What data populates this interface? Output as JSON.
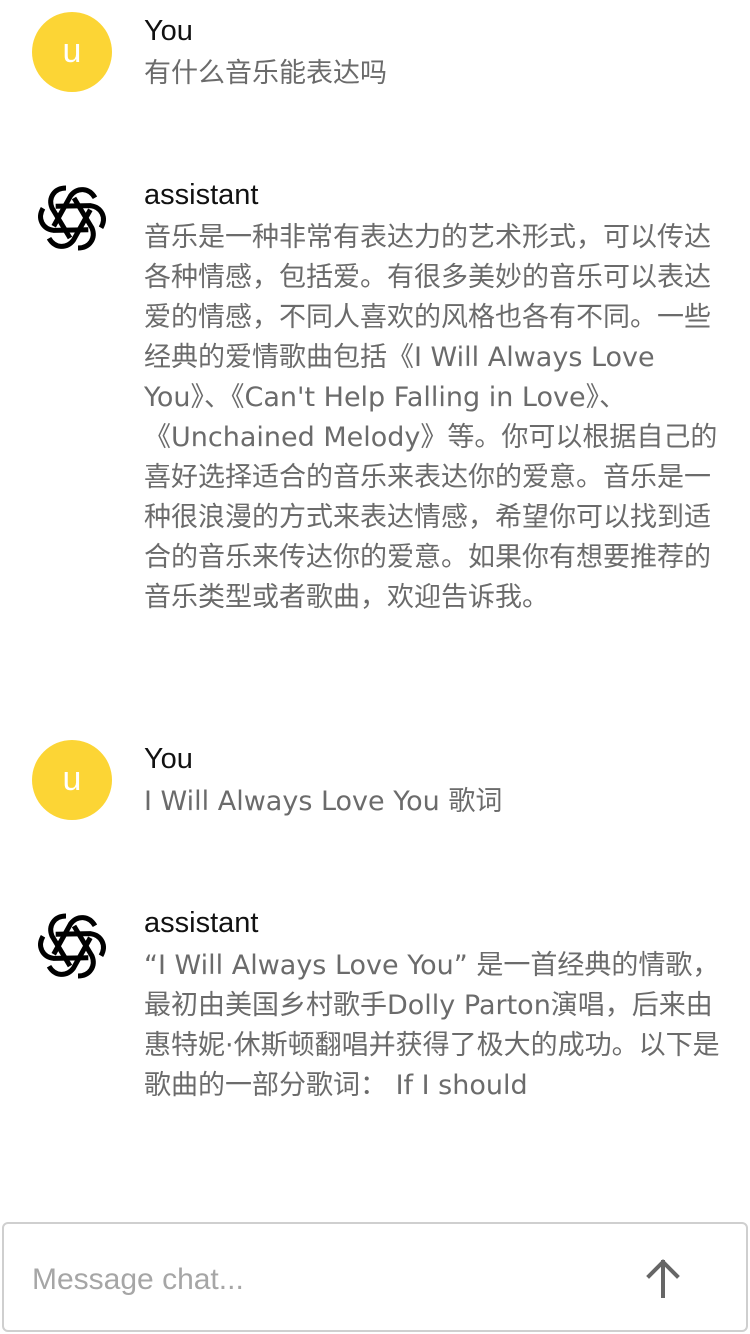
{
  "messages": [
    {
      "role": "You",
      "avatar_letter": "u",
      "text": "有什么音乐能表达吗"
    },
    {
      "role": "assistant",
      "avatar_icon": "openai-logo-icon",
      "text": "音乐是一种非常有表达力的艺术形式，可以传达各种情感，包括爱。有很多美妙的音乐可以表达爱的情感，不同人喜欢的风格也各有不同。一些经典的爱情歌曲包括《I Will Always Love You》、《Can't Help Falling in Love》、《Unchained Melody》等。你可以根据自己的喜好选择适合的音乐来表达你的爱意。音乐是一种很浪漫的方式来表达情感，希望你可以找到适合的音乐来传达你的爱意。如果你有想要推荐的音乐类型或者歌曲，欢迎告诉我。"
    },
    {
      "role": "You",
      "avatar_letter": "u",
      "text": "I Will Always Love You 歌词"
    },
    {
      "role": "assistant",
      "avatar_icon": "openai-logo-icon",
      "text": "“I Will Always Love You” 是一首经典的情歌，最初由美国乡村歌手Dolly Parton演唱，后来由惠特妮·休斯顿翻唱并获得了极大的成功。以下是歌曲的一部分歌词： If I should"
    }
  ],
  "composer": {
    "placeholder": "Message chat...",
    "send_icon": "arrow-up-icon"
  },
  "colors": {
    "user_avatar": "#fcd535",
    "role_text": "#111111",
    "message_text": "#6b6b6b",
    "placeholder": "#a6a6a6"
  }
}
